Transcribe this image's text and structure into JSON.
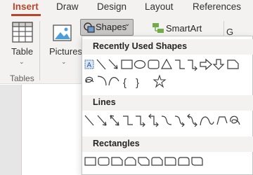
{
  "tabs": [
    {
      "label": "Insert",
      "active": true
    },
    {
      "label": "Draw",
      "active": false
    },
    {
      "label": "Design",
      "active": false
    },
    {
      "label": "Layout",
      "active": false
    },
    {
      "label": "References",
      "active": false
    }
  ],
  "ribbon": {
    "table_label": "Table",
    "tables_group_label": "Tables",
    "pictures_label": "Pictures",
    "shapes_label": "Shapes",
    "smartart_label": "SmartArt",
    "partial_label": "G"
  },
  "dropdown": {
    "recent_title": "Recently Used Shapes",
    "lines_title": "Lines",
    "rectangles_title": "Rectangles",
    "recent_text_glyphs": [
      "{",
      "}"
    ],
    "textbox_glyph": "A"
  },
  "colors": {
    "accent": "#b7472a",
    "shape_stroke": "#3b3a39",
    "textbox_blue": "#2b579a"
  },
  "icons": {
    "table": "table-icon",
    "pictures": "pictures-icon",
    "shapes": "shapes-icon",
    "smartart": "smartart-icon"
  }
}
